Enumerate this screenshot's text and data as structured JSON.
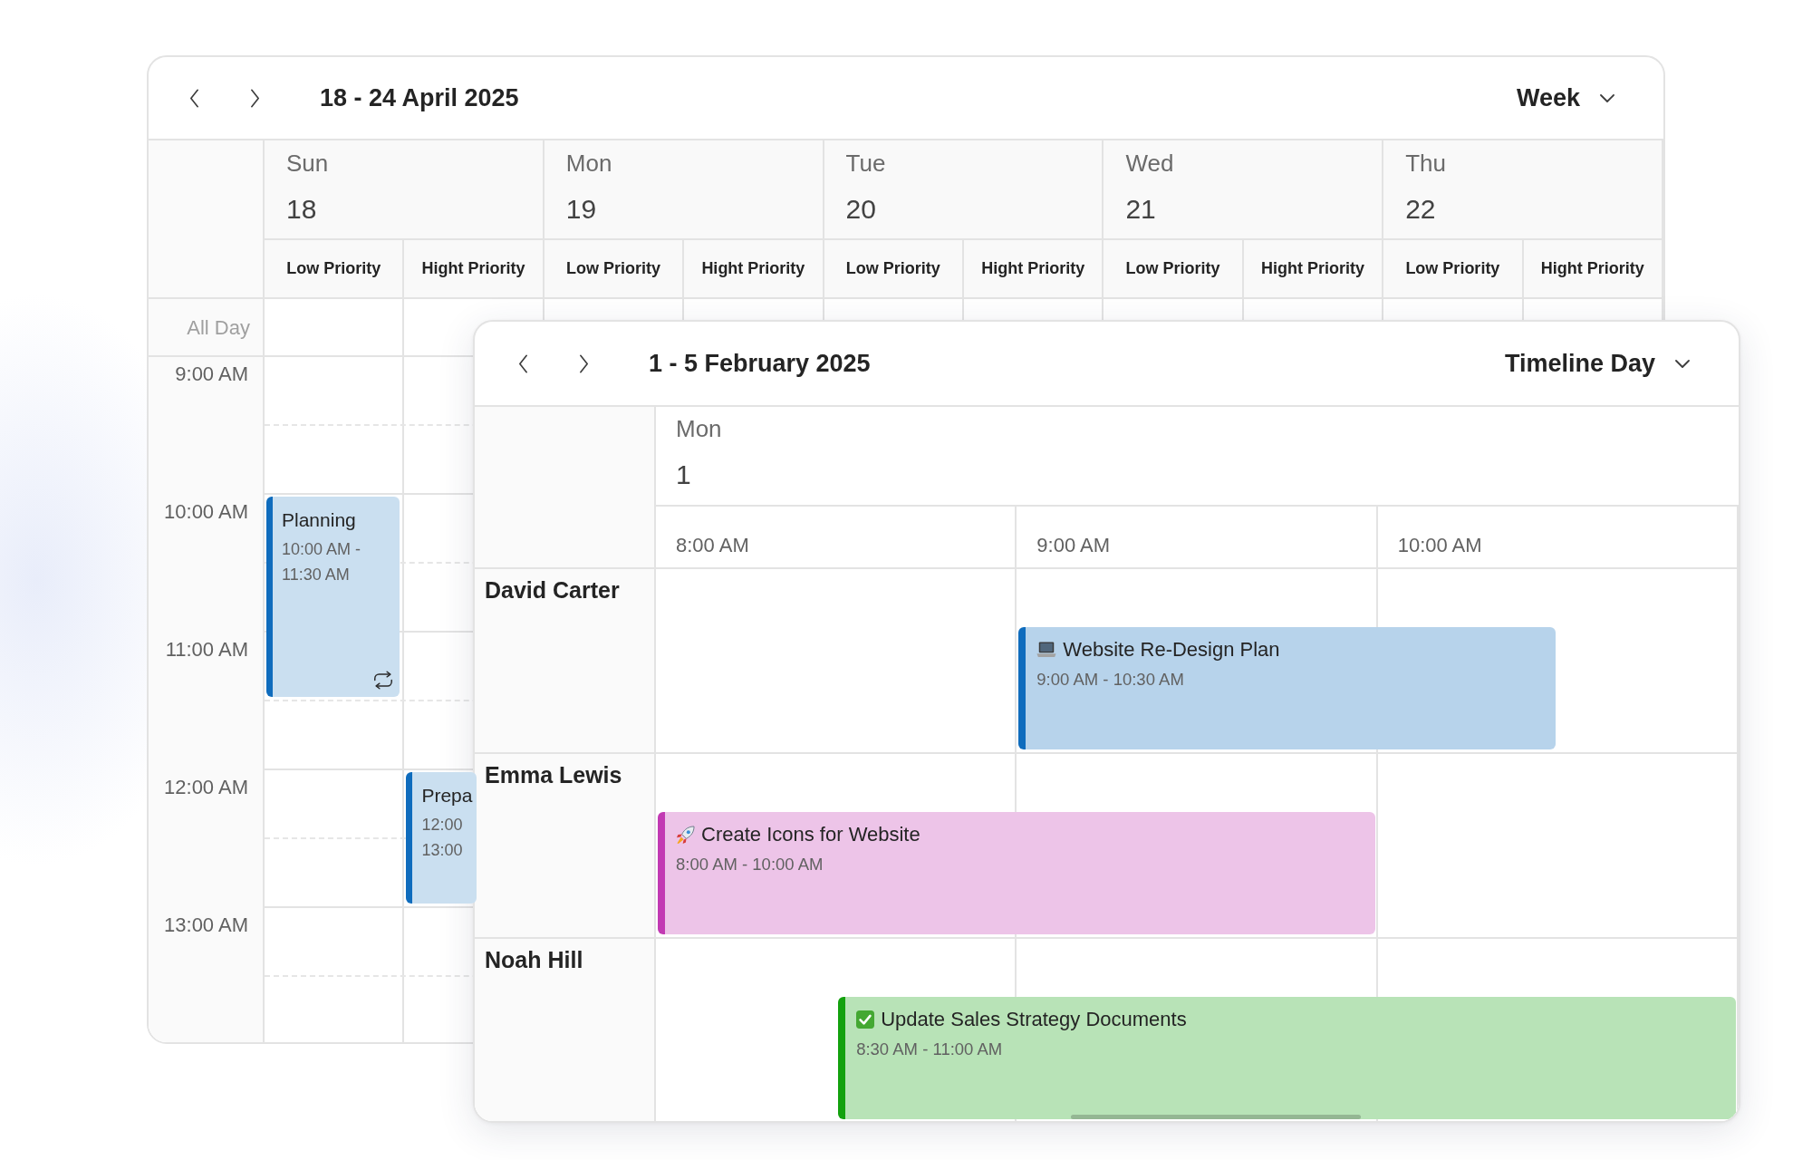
{
  "week_window": {
    "title": "18 - 24 April 2025",
    "view": "Week",
    "days": [
      {
        "name": "Sun",
        "date": "18",
        "groups": [
          "Low Priority",
          "Hight Priority"
        ]
      },
      {
        "name": "Mon",
        "date": "19",
        "groups": [
          "Low Priority",
          "Hight Priority"
        ]
      },
      {
        "name": "Tue",
        "date": "20",
        "groups": [
          "Low Priority",
          "Hight Priority"
        ]
      },
      {
        "name": "Wed",
        "date": "21",
        "groups": [
          "Low Priority",
          "Hight Priority"
        ]
      },
      {
        "name": "Thu",
        "date": "22",
        "groups": [
          "Low Priority",
          "Hight Priority"
        ]
      }
    ],
    "all_day_label": "All Day",
    "times": [
      "9:00 AM",
      "10:00 AM",
      "11:00 AM",
      "12:00 AM",
      "13:00 AM"
    ],
    "events": [
      {
        "title": "Planning",
        "time_lines": [
          "10:00 AM -",
          "11:30 AM"
        ],
        "color": "#0f6cbd",
        "recurring": true
      },
      {
        "title": "Prepa",
        "time_lines": [
          "12:00",
          "13:00"
        ],
        "color": "#0f6cbd",
        "recurring": false
      }
    ]
  },
  "timeline_window": {
    "title": "1 - 5 February 2025",
    "view": "Timeline Day",
    "day": {
      "name": "Mon",
      "date": "1"
    },
    "times": [
      "8:00 AM",
      "9:00 AM",
      "10:00 AM"
    ],
    "resources": [
      {
        "name": "David Carter",
        "events": [
          {
            "kind": "laptop",
            "title": "Website Re-Design Plan",
            "time": "9:00 AM - 10:30 AM",
            "color": "#0f6cbd"
          }
        ]
      },
      {
        "name": "Emma Lewis",
        "events": [
          {
            "kind": "rocket",
            "title": "Create Icons for Website",
            "time": "8:00 AM - 10:00 AM",
            "color": "#c239b3"
          }
        ]
      },
      {
        "name": "Noah Hill",
        "events": [
          {
            "kind": "check",
            "title": "Update Sales Strategy Documents",
            "time": "8:30 AM - 11:00 AM",
            "color": "#13a10e"
          }
        ]
      }
    ]
  }
}
